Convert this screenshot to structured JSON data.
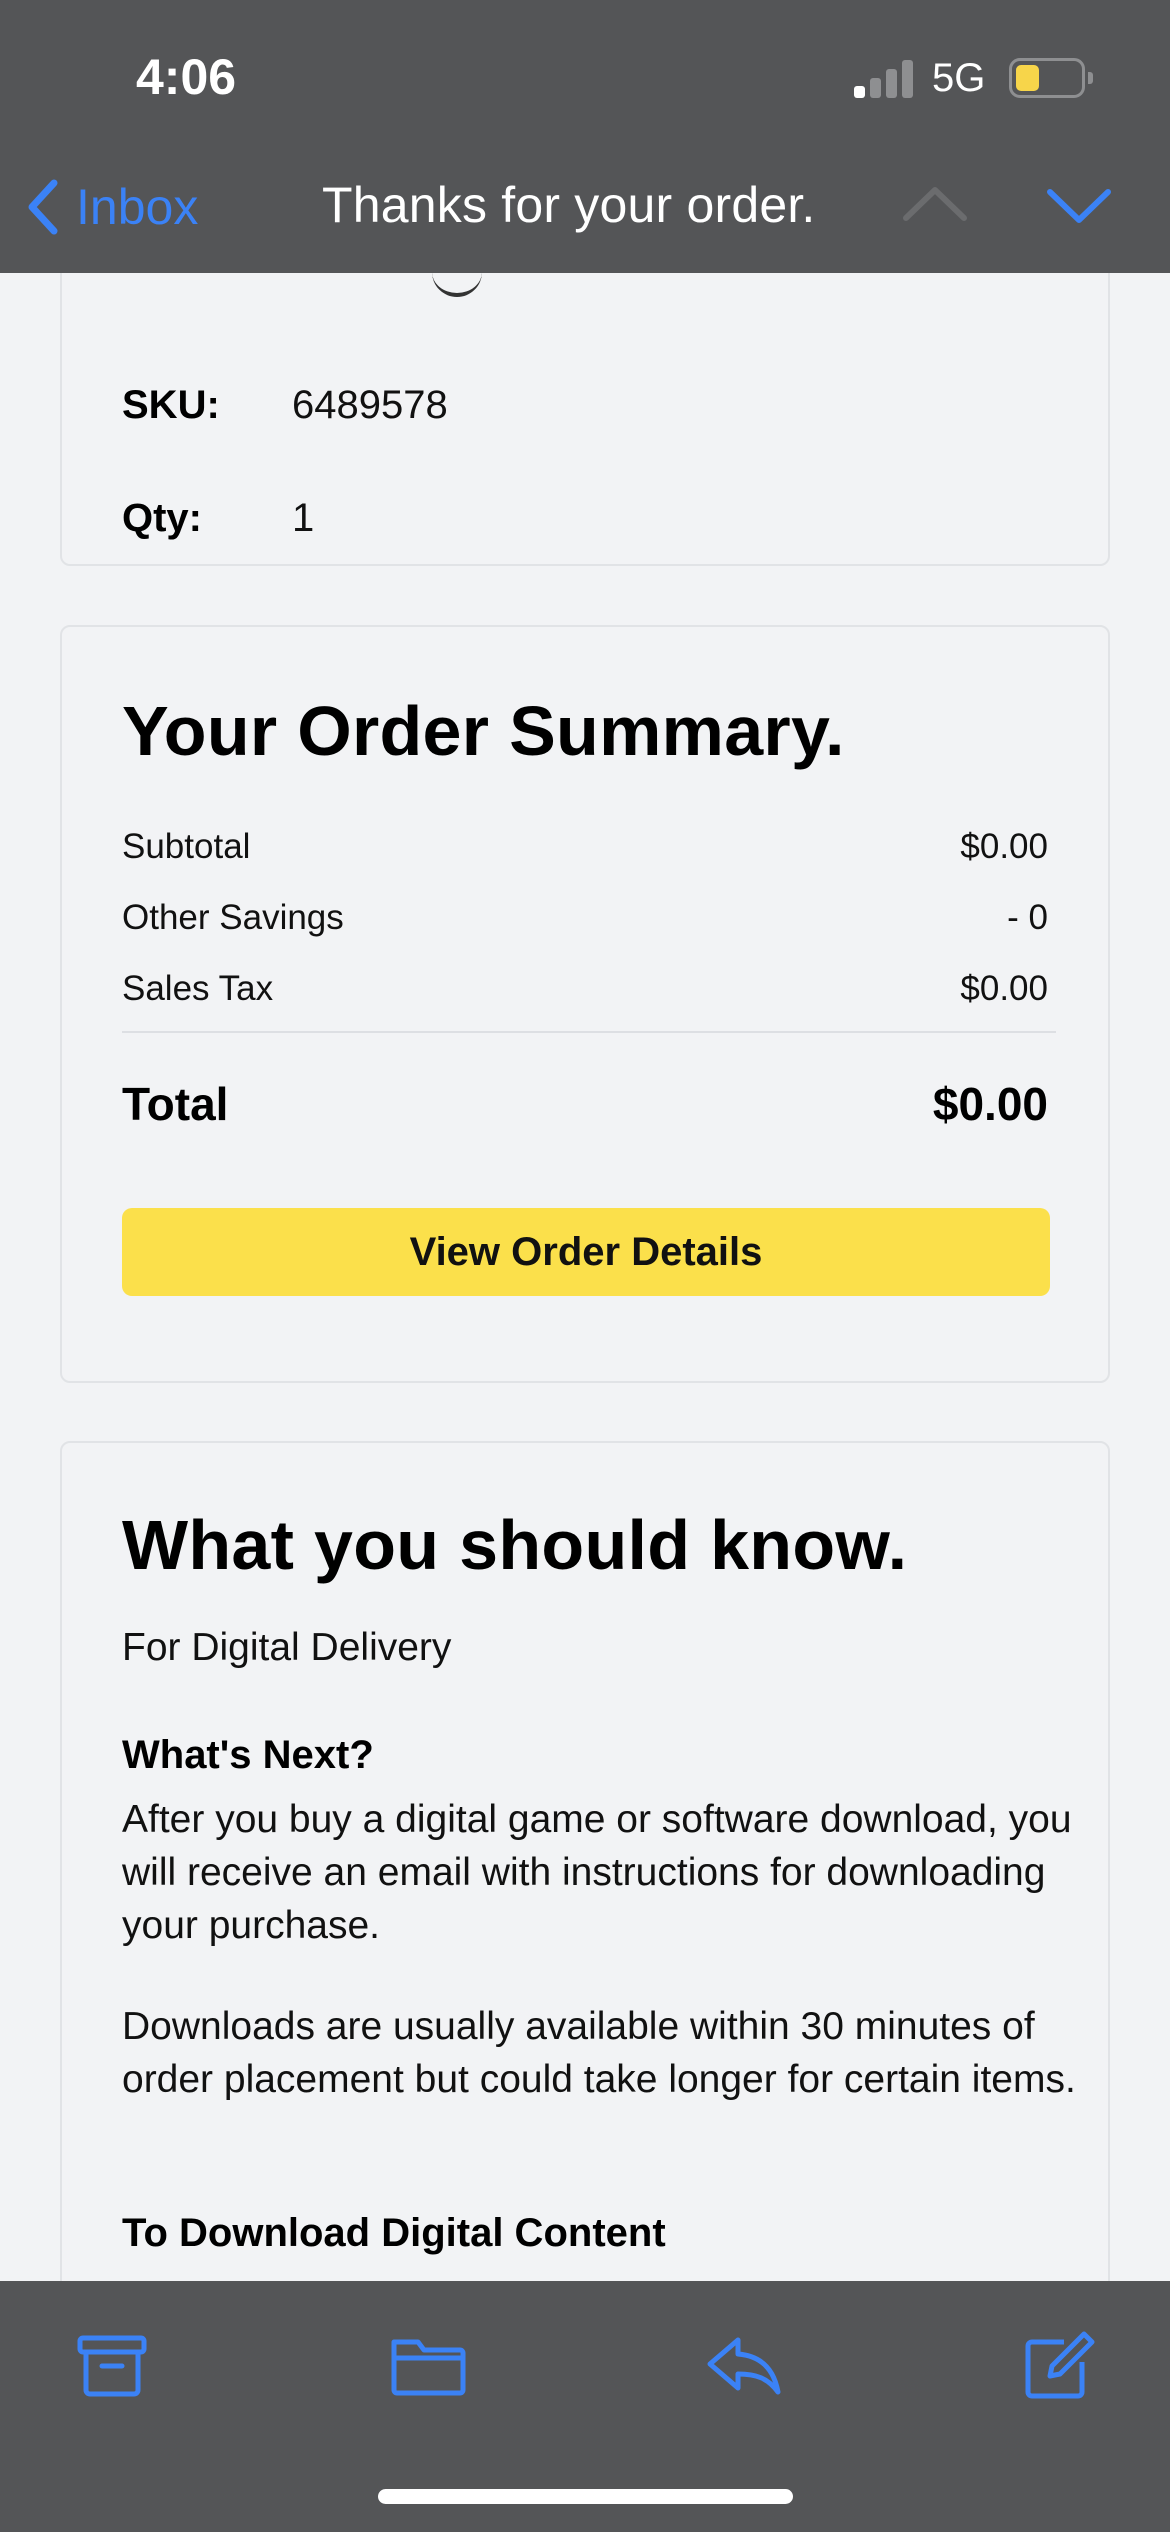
{
  "status": {
    "time": "4:06",
    "network": "5G",
    "signal_icon": "cellular-signal-icon",
    "battery_icon": "battery-low-icon"
  },
  "nav": {
    "back_label": "Inbox",
    "title": "Thanks for your order.",
    "prev_icon": "chevron-up-icon",
    "next_icon": "chevron-down-icon"
  },
  "product": {
    "sku_label": "SKU:",
    "sku_value": "6489578",
    "qty_label": "Qty:",
    "qty_value": "1"
  },
  "summary": {
    "heading": "Your Order Summary.",
    "rows": [
      {
        "label": "Subtotal",
        "value": "$0.00"
      },
      {
        "label": "Other Savings",
        "value": "- 0"
      },
      {
        "label": "Sales Tax",
        "value": "$0.00"
      }
    ],
    "total_label": "Total",
    "total_value": "$0.00",
    "button_label": "View Order Details"
  },
  "know": {
    "heading": "What you should know.",
    "intro": "For Digital Delivery",
    "subheading": "What's Next?",
    "para1": "After you buy a digital game or software download, you will receive an email with instructions for downloading your purchase.",
    "para2": "Downloads are usually available within 30 minutes of order placement but could take longer for certain items.",
    "subheading2": "To Download Digital Content"
  },
  "toolbar": {
    "archive_icon": "archive-icon",
    "folder_icon": "folder-icon",
    "reply_icon": "reply-icon",
    "compose_icon": "compose-icon"
  },
  "colors": {
    "accent": "#3b82f6",
    "cta": "#fbe04b",
    "bar_bg": "#545557",
    "page_bg": "#f2f3f5"
  }
}
